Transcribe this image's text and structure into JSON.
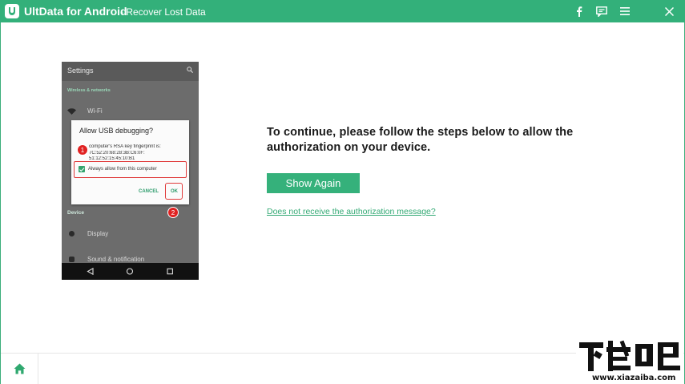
{
  "window": {
    "app_name": "UltData for Android",
    "subtitle": "- Recover Lost Data",
    "accent_color": "#33b07a",
    "title_buttons": [
      "facebook-icon",
      "feedback-icon",
      "menu-icon",
      "close-icon"
    ]
  },
  "phone": {
    "settings_title": "Settings",
    "section_wireless": "Wireless & networks",
    "item_wifi": "Wi-Fi",
    "section_device": "Device",
    "item_display": "Display",
    "item_sound": "Sound & notification",
    "dialog": {
      "title": "Allow USB debugging?",
      "body_line1": "computer's RSA key fingerprint is:",
      "body_line2": "7C:52:20:68:28:3B:C6:0F:",
      "body_line3": "51:12:52:15:45:10:B1",
      "checkbox_label": "Always allow from this computer",
      "cancel_label": "CANCEL",
      "ok_label": "OK"
    },
    "step_badges": [
      "1",
      "2"
    ]
  },
  "main": {
    "instruction": "To continue, please follow the steps below to allow the authorization on your device.",
    "show_again_label": "Show Again",
    "help_link": "Does not receive the authorization message?"
  },
  "footer": {
    "home_icon": "home-icon"
  },
  "watermark": {
    "url": "www.xiazaiba.com"
  }
}
